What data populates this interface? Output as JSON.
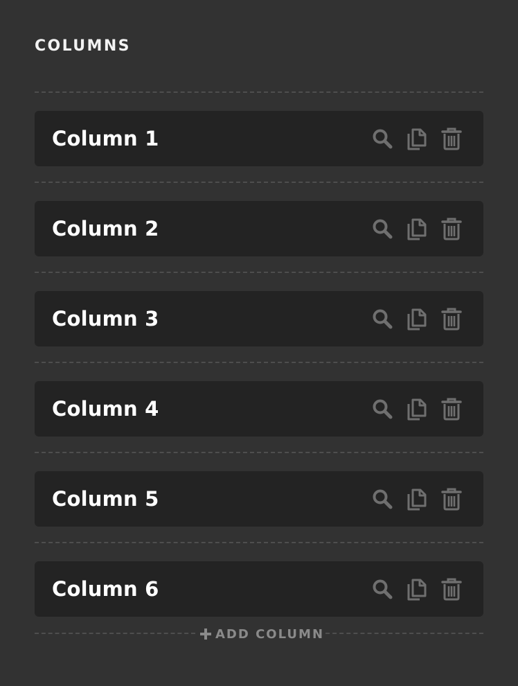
{
  "panel": {
    "title": "COLUMNS"
  },
  "columns": [
    {
      "label": "Column 1"
    },
    {
      "label": "Column 2"
    },
    {
      "label": "Column 3"
    },
    {
      "label": "Column 4"
    },
    {
      "label": "Column 5"
    },
    {
      "label": "Column 6"
    }
  ],
  "row_actions": [
    "search-icon",
    "copy-icon",
    "trash-icon"
  ],
  "add_column": {
    "label": "ADD COLUMN",
    "icon": "plus-icon"
  },
  "colors": {
    "background": "#323232",
    "row_background": "#232323",
    "text": "#ffffff",
    "icon": "#6f6f6f",
    "muted": "#8a8a8a"
  }
}
